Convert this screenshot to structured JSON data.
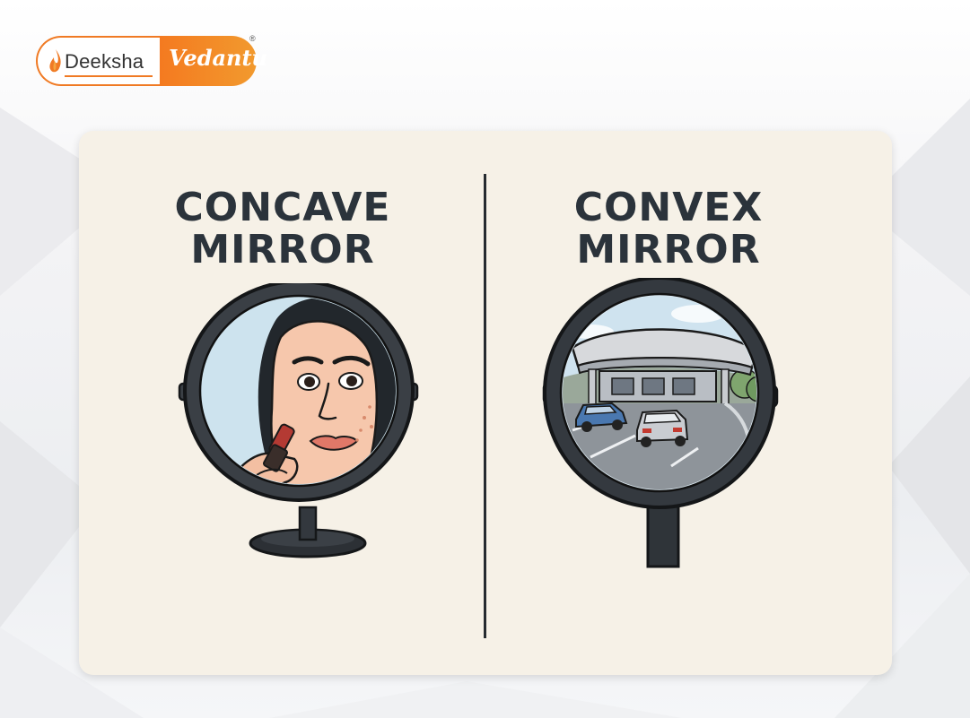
{
  "logo": {
    "left_text": "Deeksha",
    "right_text": "Vedantu",
    "registered_mark": "®",
    "colors": {
      "orange": "#F47A20",
      "text": "#333333"
    }
  },
  "card": {
    "background": "#F6F1E7",
    "panels": [
      {
        "title_lines": [
          "CONCAVE",
          "MIRROR"
        ],
        "illustration": "woman-applying-lipstick-in-tabletop-mirror"
      },
      {
        "title_lines": [
          "CONVEX",
          "MIRROR"
        ],
        "illustration": "convex-traffic-mirror-reflecting-cars-and-toll-plaza"
      }
    ]
  }
}
